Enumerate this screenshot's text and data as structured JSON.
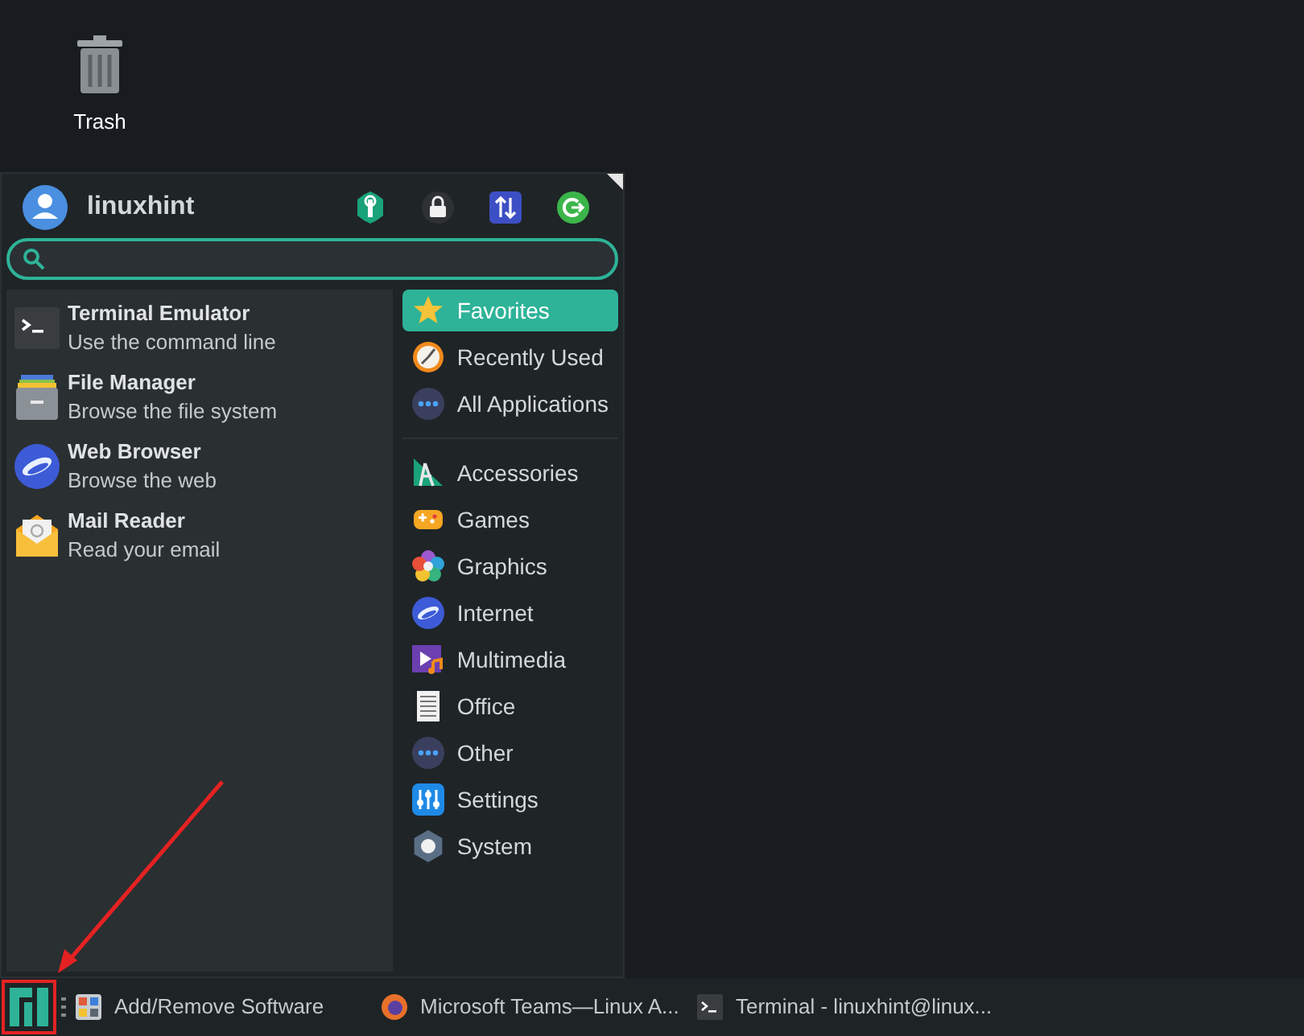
{
  "desktop_icons": [
    {
      "label": "Trash"
    }
  ],
  "menu": {
    "user": "linuxhint",
    "favorites": [
      {
        "name": "Terminal Emulator",
        "description": "Use the command line"
      },
      {
        "name": "File Manager",
        "description": "Browse the file system"
      },
      {
        "name": "Web Browser",
        "description": "Browse the web"
      },
      {
        "name": "Mail Reader",
        "description": "Read your email"
      }
    ],
    "views": [
      {
        "label": "Favorites",
        "selected": true
      },
      {
        "label": "Recently Used",
        "selected": false
      },
      {
        "label": "All Applications",
        "selected": false
      }
    ],
    "categories": [
      {
        "label": "Accessories",
        "selected": false
      },
      {
        "label": "Games",
        "selected": false
      },
      {
        "label": "Graphics",
        "selected": false
      },
      {
        "label": "Internet",
        "selected": false
      },
      {
        "label": "Multimedia",
        "selected": false
      },
      {
        "label": "Office",
        "selected": false
      },
      {
        "label": "Other",
        "selected": false
      },
      {
        "label": "Settings",
        "selected": false
      },
      {
        "label": "System",
        "selected": false
      }
    ]
  },
  "taskbar": {
    "tasks": [
      {
        "label": "Add/Remove Software"
      },
      {
        "label": "Microsoft Teams—Linux A..."
      },
      {
        "label": "Terminal - linuxhint@linux..."
      }
    ]
  }
}
